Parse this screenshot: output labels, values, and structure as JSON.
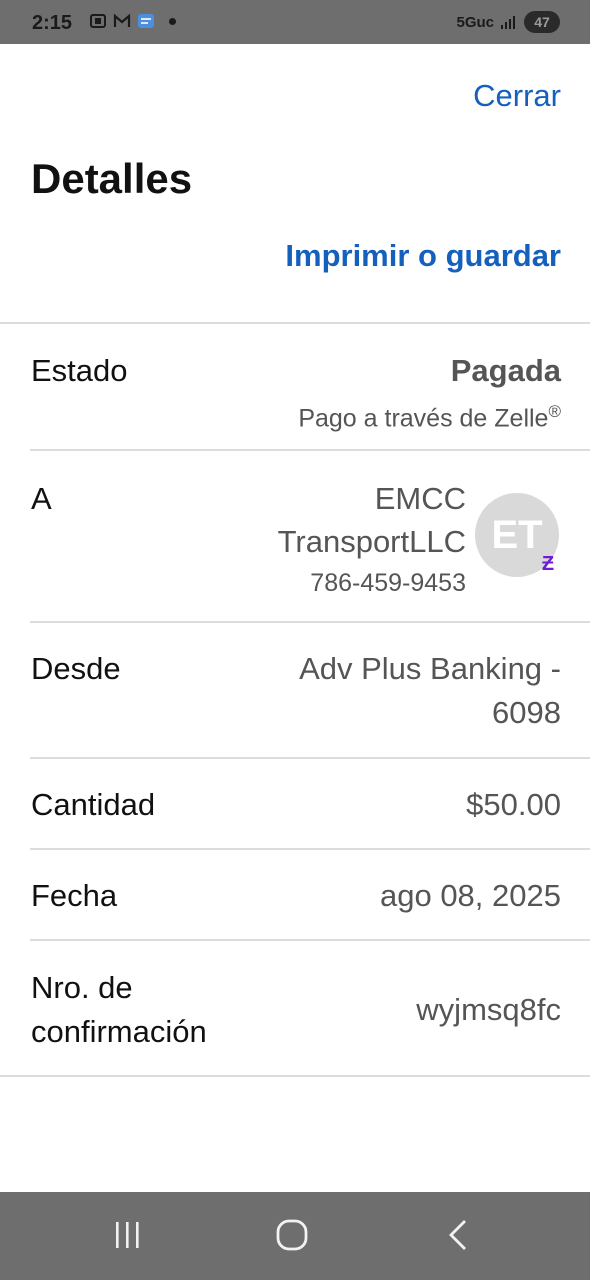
{
  "status_bar": {
    "time": "2:15",
    "network": "5Guc",
    "battery": "47"
  },
  "header": {
    "close_label": "Cerrar",
    "title": "Detalles",
    "print_label": "Imprimir o guardar"
  },
  "details": {
    "status": {
      "label": "Estado",
      "value": "Pagada",
      "sub": "Pago a través de Zelle",
      "sub_mark": "®"
    },
    "recipient": {
      "label": "A",
      "name_line1": "EMCC",
      "name_line2": "TransportLLC",
      "phone": "786-459-9453",
      "initials": "ET",
      "badge_icon": "zelle-icon"
    },
    "from": {
      "label": "Desde",
      "value_line1": "Adv Plus Banking -",
      "value_line2": "6098"
    },
    "amount": {
      "label": "Cantidad",
      "value": "$50.00"
    },
    "date": {
      "label": "Fecha",
      "value": "ago 08, 2025"
    },
    "confirmation": {
      "label_line1": "Nro. de",
      "label_line2": "confirmación",
      "value": "wyjmsq8fc"
    }
  },
  "colors": {
    "accent": "#1560bd",
    "zelle": "#6d1ed4",
    "bars": "#6e6e6e"
  },
  "nav": {
    "recents_icon": "recents-icon",
    "home_icon": "home-icon",
    "back_icon": "back-icon"
  }
}
